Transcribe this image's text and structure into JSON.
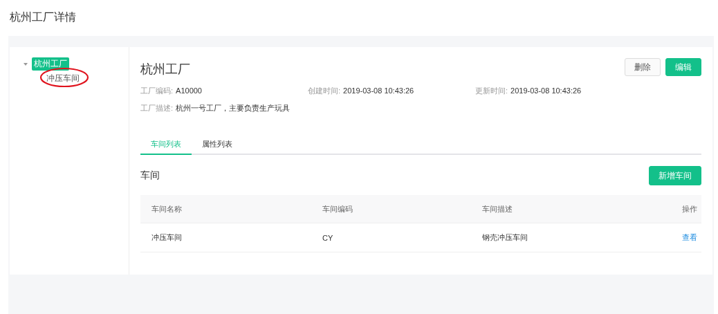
{
  "page_title": "杭州工厂详情",
  "tree": [
    {
      "label": "杭州工厂",
      "selected": true,
      "expanded": true,
      "children": [
        {
          "label": "冲压车间",
          "selected": false,
          "circled": true
        }
      ]
    }
  ],
  "factory": {
    "name": "杭州工厂",
    "fields": [
      {
        "label": "工厂编码:",
        "value": "A10000"
      },
      {
        "label": "创建时间:",
        "value": "2019-03-08 10:43:26"
      },
      {
        "label": "更新时间:",
        "value": "2019-03-08 10:43:26"
      },
      {
        "label": "工厂描述:",
        "value": "杭州一号工厂，主要负责生产玩具"
      }
    ],
    "buttons": [
      {
        "label": "删除",
        "kind": "default"
      },
      {
        "label": "编辑",
        "kind": "primary"
      }
    ]
  },
  "tabs": [
    {
      "label": "车间列表",
      "selected": true
    },
    {
      "label": "属性列表",
      "selected": false
    }
  ],
  "section": {
    "title": "车间",
    "button": "新增车间"
  },
  "table": {
    "columns": [
      "车间名称",
      "车间编码",
      "车间描述",
      "操作"
    ],
    "rows": [
      {
        "cells": [
          "冲压车间",
          "CY",
          "钢壳冲压车间"
        ],
        "action": "查看"
      }
    ]
  }
}
